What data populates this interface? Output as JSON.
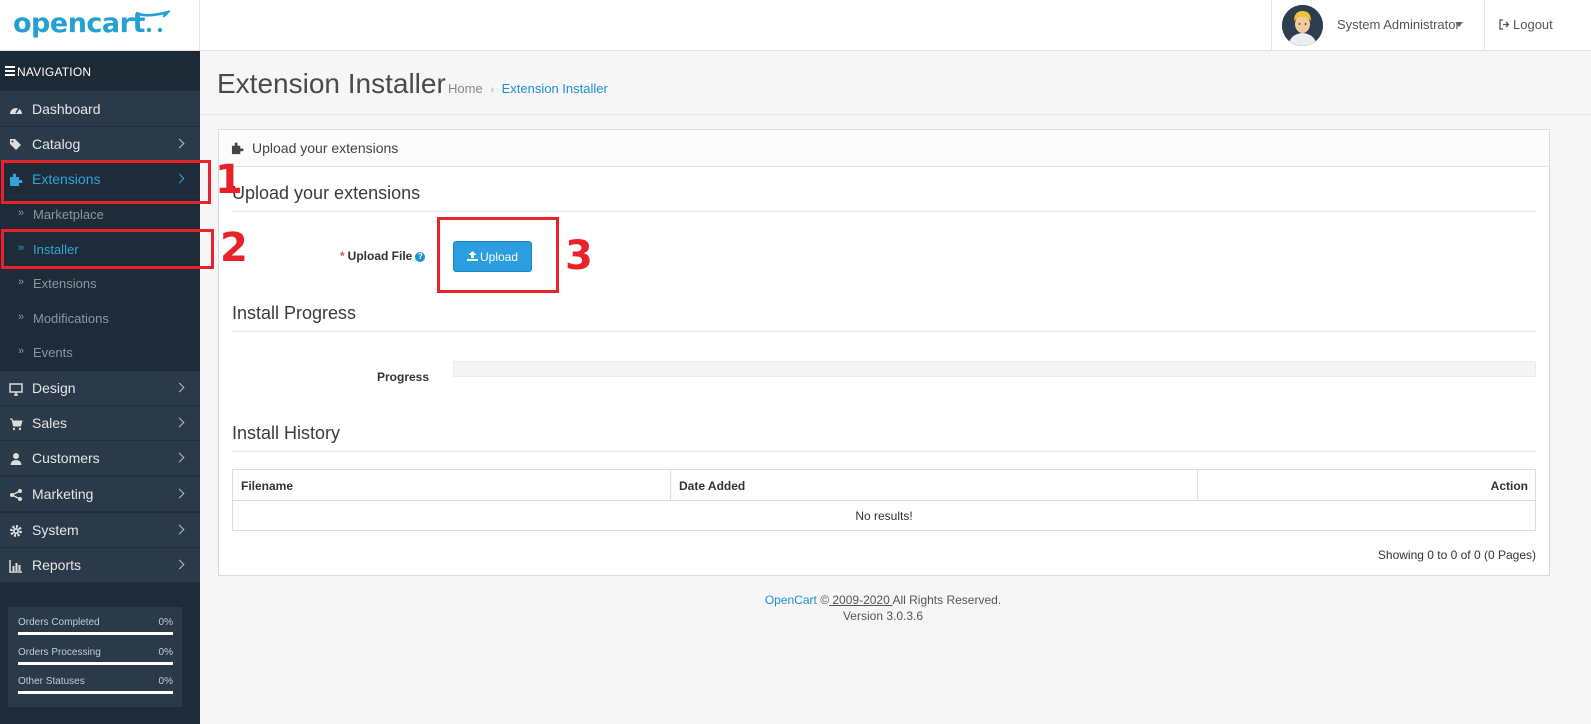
{
  "header": {
    "logo_text": "opencart",
    "user_name": "System Administrator",
    "logout_label": "Logout"
  },
  "sidebar": {
    "nav_title": "NAVIGATION",
    "items": [
      {
        "label": "Dashboard",
        "icon": "dashboard-icon"
      },
      {
        "label": "Catalog",
        "icon": "tags-icon"
      },
      {
        "label": "Extensions",
        "icon": "puzzle-icon",
        "active": true
      },
      {
        "label": "Design",
        "icon": "monitor-icon"
      },
      {
        "label": "Sales",
        "icon": "cart-icon"
      },
      {
        "label": "Customers",
        "icon": "user-icon"
      },
      {
        "label": "Marketing",
        "icon": "share-icon"
      },
      {
        "label": "System",
        "icon": "gear-icon"
      },
      {
        "label": "Reports",
        "icon": "bar-chart-icon"
      }
    ],
    "extensions_sub": [
      {
        "label": "Marketplace"
      },
      {
        "label": "Installer",
        "active": true
      },
      {
        "label": "Extensions"
      },
      {
        "label": "Modifications"
      },
      {
        "label": "Events"
      }
    ],
    "stats": [
      {
        "label": "Orders Completed",
        "percent": "0%"
      },
      {
        "label": "Orders Processing",
        "percent": "0%"
      },
      {
        "label": "Other Statuses",
        "percent": "0%"
      }
    ]
  },
  "page": {
    "title": "Extension Installer",
    "breadcrumb": [
      "Home",
      "Extension Installer"
    ]
  },
  "panel": {
    "heading": "Upload your extensions",
    "upload_section": "Upload your extensions",
    "upload_label": "Upload File",
    "required_mark": "*",
    "help_mark": "?",
    "upload_button": "Upload",
    "progress_section": "Install Progress",
    "progress_label": "Progress",
    "progress_value": 0,
    "history_section": "Install History",
    "table_headers": [
      "Filename",
      "Date Added",
      "Action"
    ],
    "no_results": "No results!",
    "pagination": "Showing 0 to 0 of 0 (0 Pages)"
  },
  "footer": {
    "brand": "OpenCart",
    "copyright_symbol": "©",
    "years": " 2009-2020 ",
    "rights": "All Rights Reserved.",
    "version": "Version 3.0.3.6"
  },
  "annotations": {
    "colors": {
      "callout": "#e8212b",
      "accent": "#1e91cf",
      "sidebar": "#1e2b38"
    },
    "callouts": [
      "1",
      "2",
      "3"
    ]
  }
}
